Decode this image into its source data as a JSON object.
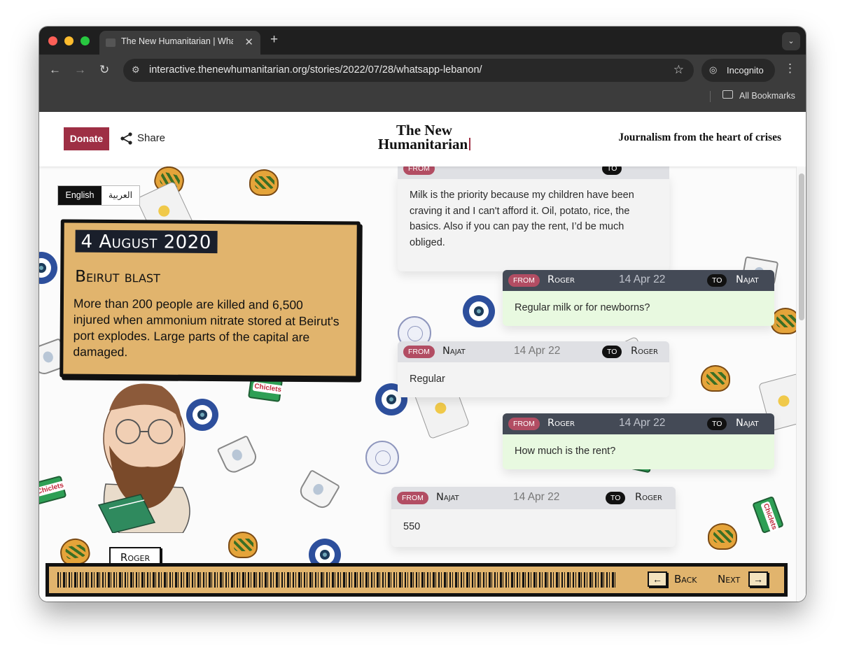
{
  "browser": {
    "tab_title": "The New Humanitarian | What",
    "url": "interactive.thenewhumanitarian.org/stories/2022/07/28/whatsapp-lebanon/",
    "incognito_label": "Incognito",
    "bookmarks_label": "All Bookmarks"
  },
  "header": {
    "donate_label": "Donate",
    "share_label": "Share",
    "logo_line1": "The New",
    "logo_line2": "Humanitarian",
    "tagline": "Journalism from the heart of crises"
  },
  "language": {
    "english": "English",
    "arabic": "العربية"
  },
  "event": {
    "date": "4 August 2020",
    "title": "Beirut blast",
    "body": "More than 200 people are killed and 6,500 injured when ammonium nitrate stored at Beirut's port explodes. Large parts of the capital are damaged."
  },
  "portrait": {
    "name": "Roger"
  },
  "messages": {
    "from_label": "FROM",
    "to_label": "TO",
    "items": [
      {
        "sender": "",
        "date": "",
        "recipient": "",
        "text": "Milk is the priority because my children have been craving it and I can't afford it. Oil, potato, rice, the basics. Also if you can pay the rent, I’d be much obliged."
      },
      {
        "sender": "Roger",
        "date": "14 Apr 22",
        "recipient": "Najat",
        "text": "Regular milk or for newborns?"
      },
      {
        "sender": "Najat",
        "date": "14 Apr 22",
        "recipient": "Roger",
        "text": "Regular"
      },
      {
        "sender": "Roger",
        "date": "14 Apr 22",
        "recipient": "Najat",
        "text": "How much is the rent?"
      },
      {
        "sender": "Najat",
        "date": "14 Apr 22",
        "recipient": "Roger",
        "text": "550"
      }
    ]
  },
  "nav": {
    "back_label": "Back",
    "next_label": "Next"
  },
  "colors": {
    "accent": "#9e2f44",
    "card": "#e1b46d",
    "outgoing_bubble": "#e8f9e0",
    "outgoing_header": "#444a56",
    "incoming_header": "#dfe0e4"
  }
}
